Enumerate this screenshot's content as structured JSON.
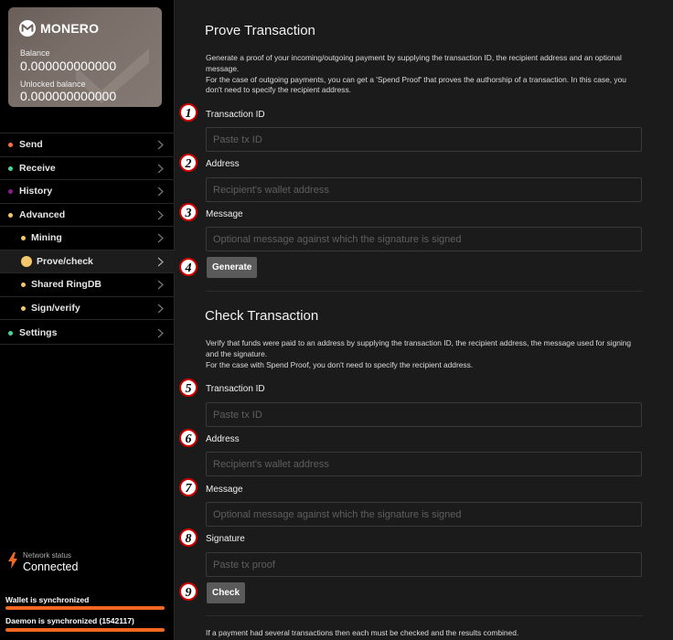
{
  "wallet": {
    "name": "MONERO",
    "balance_label": "Balance",
    "balance": "0.000000000000",
    "unlocked_label": "Unlocked balance",
    "unlocked": "0.000000000000"
  },
  "menu": [
    {
      "label": "Send",
      "color": "#ff6e40"
    },
    {
      "label": "Receive",
      "color": "#46d69a"
    },
    {
      "label": "History",
      "color": "#6b0072"
    },
    {
      "label": "Advanced",
      "color": "#f4c76a"
    },
    {
      "label": "Mining",
      "color": "#f4c76a"
    },
    {
      "label": "Prove/check",
      "color": "#f4c76a"
    },
    {
      "label": "Shared RingDB",
      "color": "#f4c76a"
    },
    {
      "label": "Sign/verify",
      "color": "#f4c76a"
    },
    {
      "label": "Settings",
      "color": "#46d69a"
    }
  ],
  "network": {
    "label": "Network status",
    "value": "Connected",
    "icon": "lightning-icon"
  },
  "sync": {
    "wallet_label": "Wallet is synchronized",
    "wallet_progress": 1.0,
    "daemon_label": "Daemon is synchronized (1542117)",
    "daemon_progress": 1.0
  },
  "prove": {
    "title": "Prove Transaction",
    "description_1": "Generate a proof of your incoming/outgoing payment by supplying the transaction ID, the recipient address and an optional message.",
    "description_2": "For the case of outgoing payments, you can get a 'Spend Proof' that proves the authorship of a transaction. In this case, you don't need to specify the recipient address.",
    "txid_label": "Transaction ID",
    "txid_placeholder": "Paste tx ID",
    "address_label": "Address",
    "address_placeholder": "Recipient's wallet address",
    "message_label": "Message",
    "message_placeholder": "Optional message against which the signature is signed",
    "button": "Generate"
  },
  "check": {
    "title": "Check Transaction",
    "description_1": "Verify that funds were paid to an address by supplying the transaction ID, the recipient address, the message used for signing and the signature.",
    "description_2": "For the case with Spend Proof, you don't need to specify the recipient address.",
    "txid_label": "Transaction ID",
    "txid_placeholder": "Paste tx ID",
    "address_label": "Address",
    "address_placeholder": "Recipient's wallet address",
    "message_label": "Message",
    "message_placeholder": "Optional message against which the signature is signed",
    "signature_label": "Signature",
    "signature_placeholder": "Paste tx proof",
    "button": "Check"
  },
  "footer_note": "If a payment had several transactions then each must be checked and the results combined.",
  "badges": [
    "1",
    "2",
    "3",
    "4",
    "5",
    "6",
    "7",
    "8",
    "9"
  ]
}
